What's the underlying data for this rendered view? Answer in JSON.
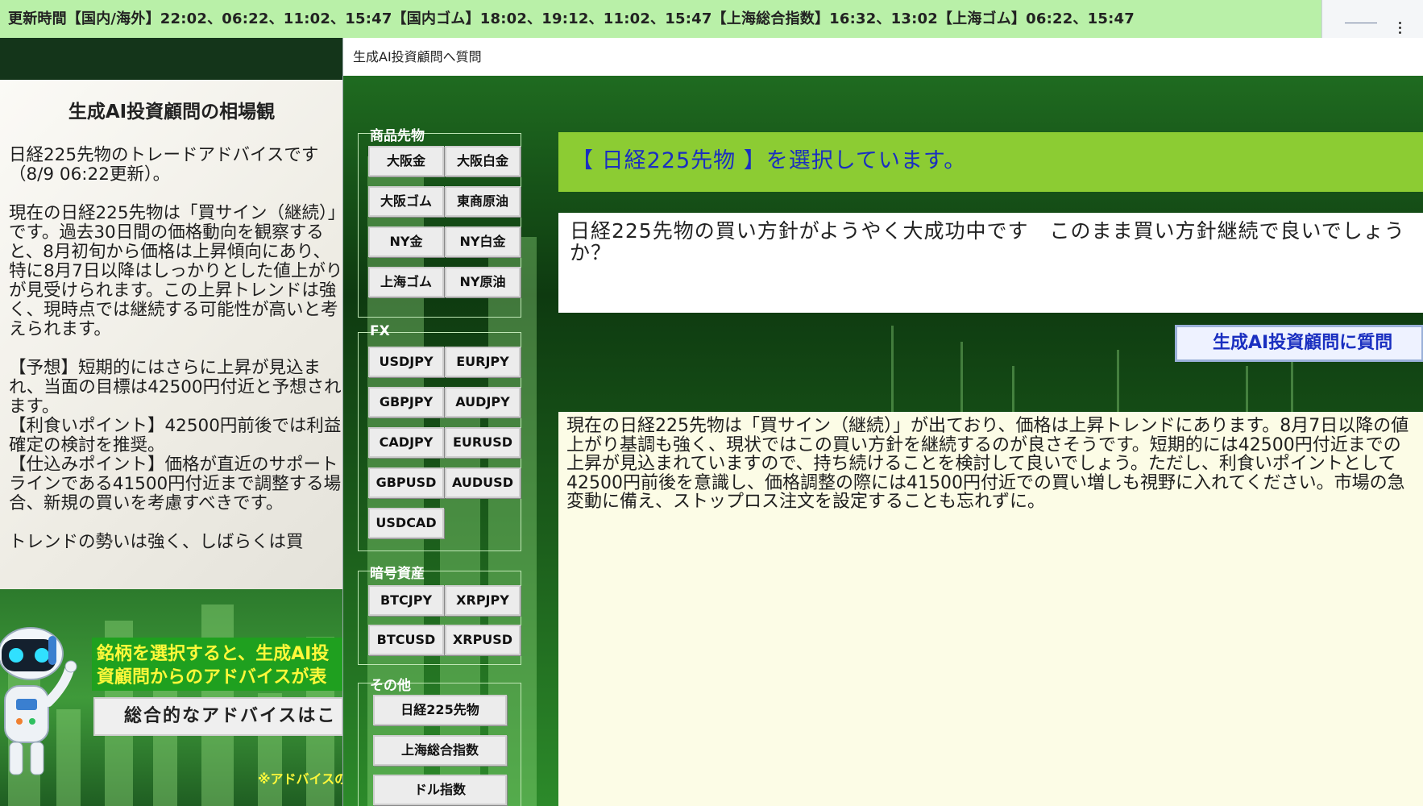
{
  "ticker": {
    "text": "更新時間【国内/海外】22:02、06:22、11:02、15:47【国内ゴム】18:02、19:12、11:02、15:47【上海総合指数】16:32、13:02【上海ゴム】06:22、15:47"
  },
  "left_panel": {
    "title": "生成AI投資顧問の相場観",
    "body": "日経225先物のトレードアドバイスです（8/9 06:22更新）。\n\n現在の日経225先物は「買サイン（継続）」です。過去30日間の価格動向を観察すると、8月初旬から価格は上昇傾向にあり、特に8月7日以降はしっかりとした値上がりが見受けられます。この上昇トレンドは強く、現時点では継続する可能性が高いと考えられます。\n\n【予想】短期的にはさらに上昇が見込まれ、当面の目標は42500円付近と予想されます。\n【利食いポイント】42500円前後では利益確定の検討を推奨。\n【仕込みポイント】価格が直近のサポートラインである41500円付近まで調整する場合、新規の買いを考慮すべきです。\n\nトレンドの勢いは強く、しばらくは買",
    "guide_text": "銘柄を選択すると、生成AI投資顧問からのアドバイスが表示されます。",
    "overall_button": "総合的なアドバイスはこ",
    "note": "※アドバイスの"
  },
  "dialog": {
    "title": "生成AI投資顧問へ質問",
    "groups": {
      "commodities": {
        "label": "商品先物",
        "buttons": [
          "大阪金",
          "大阪白金",
          "大阪ゴム",
          "東商原油",
          "NY金",
          "NY白金",
          "上海ゴム",
          "NY原油"
        ]
      },
      "fx": {
        "label": "FX",
        "buttons": [
          "USDJPY",
          "EURJPY",
          "GBPJPY",
          "AUDJPY",
          "CADJPY",
          "EURUSD",
          "GBPUSD",
          "AUDUSD",
          "USDCAD"
        ]
      },
      "crypto": {
        "label": "暗号資産",
        "buttons": [
          "BTCJPY",
          "XRPJPY",
          "BTCUSD",
          "XRPUSD"
        ]
      },
      "other": {
        "label": "その他",
        "buttons": [
          "日経225先物",
          "上海総合指数",
          "ドル指数"
        ]
      }
    },
    "selected_text": "【 日経225先物 】を選択しています。",
    "question_text": "日経225先物の買い方針がようやく大成功中です　このまま買い方針継続で良いでしょうか？",
    "ask_button": "生成AI投資顧問に質問",
    "answer_text": "現在の日経225先物は「買サイン（継続）」が出ており、価格は上昇トレンドにあります。8月7日以降の値上がり基調も強く、現状ではこの買い方針を継続するのが良さそうです。短期的には42500円付近までの上昇が見込まれていますので、持ち続けることを検討して良いでしょう。ただし、利食いポイントとして42500円前後を意識し、価格調整の際には41500円付近での買い増しも視野に入れてください。市場の急変動に備え、ストップロス注文を設定することも忘れずに。"
  },
  "colors": {
    "ticker_bg": "#b9f0a8",
    "selected_bar": "#8ccc33",
    "selected_text": "#1a2fc0",
    "guide_bg": "#1fa01f",
    "guide_text": "#fff83a",
    "answer_bg": "#fcfce6"
  }
}
